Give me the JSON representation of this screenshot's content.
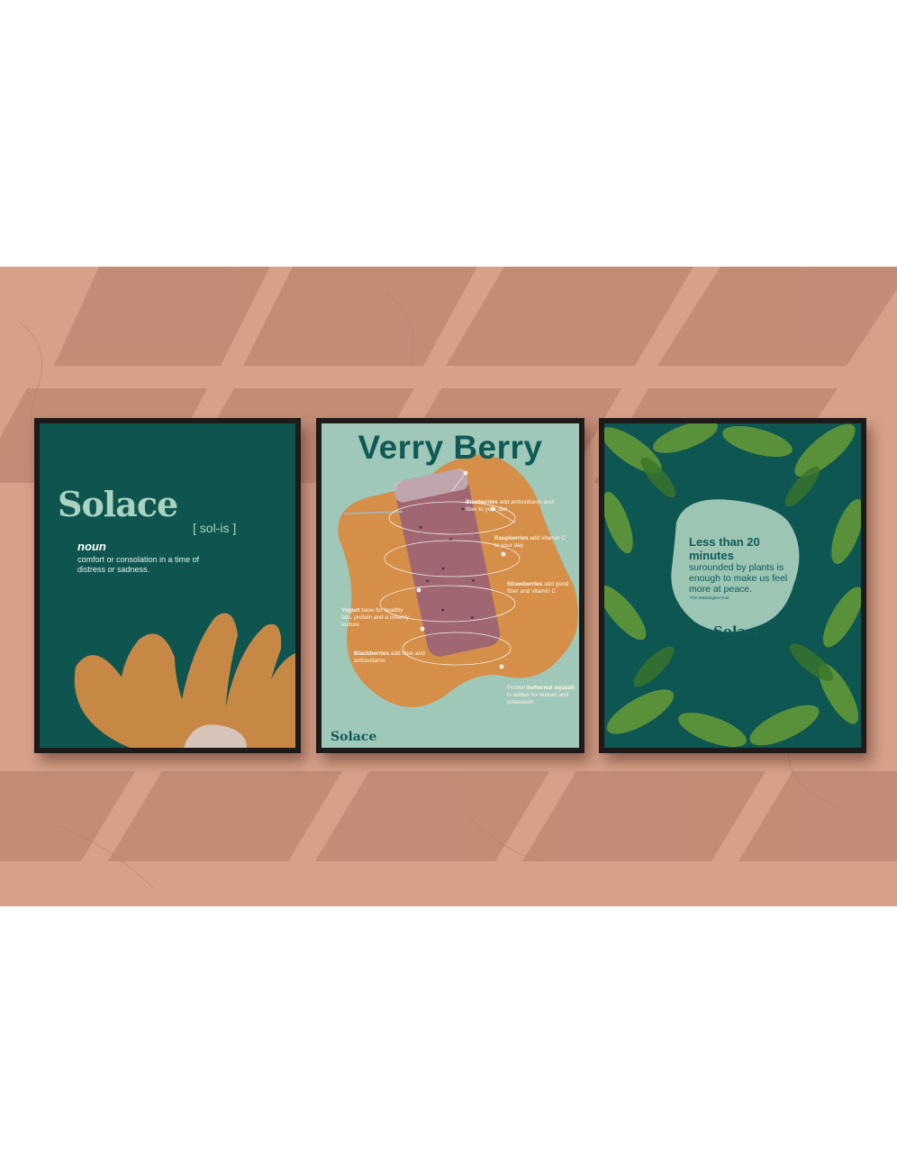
{
  "poster1": {
    "logo": "Solace",
    "pronunciation": "[ sol-is ]",
    "part_of_speech": "noun",
    "definition": "comfort or consolation in a time of distress or sadness."
  },
  "poster2": {
    "title": "Verry Berry",
    "annotations": [
      {
        "bold": "Blueberries",
        "text": " add antioxidants and fiber to your diet"
      },
      {
        "bold": "Raspberries",
        "text": " add vitamin C to your day"
      },
      {
        "bold": "Strawberries",
        "text": " add good fiber and vitamin C"
      },
      {
        "bold": "Yogurt",
        "text": " base for healthy fats, protein and a creamy texture"
      },
      {
        "bold": "Blackberries",
        "text": " add fiber and antioxidants"
      },
      {
        "prefix": "Frozen ",
        "bold": "butternut squash",
        "text": " is added for texture and potassium"
      }
    ],
    "logo": "Solace"
  },
  "poster3": {
    "headline": "Less than 20 minutes",
    "body": "surounded by plants is enough to make us feel more at peace.",
    "source": "-The Washington Post",
    "logo": "Solace"
  },
  "colors": {
    "wall": "#d7a189",
    "teal": "#0f5a56",
    "mint": "#a9d2c1",
    "orange": "#e2954b",
    "frame": "#1e1a19"
  }
}
